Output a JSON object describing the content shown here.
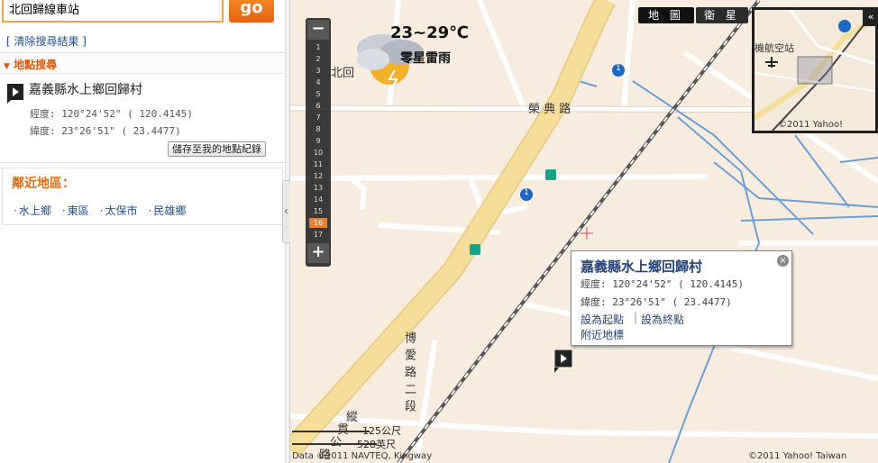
{
  "search": {
    "value": "北回歸線車站",
    "go_label": "go"
  },
  "sidebar": {
    "clear_results": "[ 清除搜尋結果 ]",
    "section_title": "地點搜尋",
    "result": {
      "title": "嘉義縣水上鄉回歸村",
      "longitude": "經度: 120°24'52\"  ( 120.4145)",
      "latitude": "緯度:  23°26'51\"  (  23.4477)",
      "save_label": "儲存至我的地點紀錄"
    },
    "nearby": {
      "title": "鄰近地區：",
      "items": [
        "水上鄉",
        "東區",
        "太保市",
        "民雄鄉"
      ]
    }
  },
  "map": {
    "zoom_levels": [
      "1",
      "2",
      "3",
      "4",
      "5",
      "6",
      "7",
      "8",
      "9",
      "10",
      "11",
      "12",
      "13",
      "14",
      "15",
      "16",
      "17"
    ],
    "active_zoom": "16",
    "weather": {
      "temp": "23~29℃",
      "desc": "零星雷雨"
    },
    "maptype": {
      "map_label": "地 圖",
      "satellite_label": "衛 星"
    },
    "minimap": {
      "label": "機航空站",
      "copyright": "©2011 Yahoo!",
      "toggle": "«"
    },
    "labels": {
      "rongdian_road": "榮 典 路",
      "beihui": "北回",
      "boai_road": "博愛路二段",
      "zong": "縱",
      "guan": "貫",
      "gong": "公",
      "lu": "路",
      "highway_shield": "1"
    },
    "popup": {
      "title": "嘉義縣水上鄉回歸村",
      "longitude": "經度: 120°24'52\"  ( 120.4145)",
      "latitude": "緯度:  23°26'51\"  (  23.4477)",
      "set_start": "設為起點",
      "set_end": "設為終點",
      "separator": "|",
      "nearby": "附近地標",
      "close": "×"
    },
    "scale": {
      "metric": "125公尺",
      "imperial": "528英尺"
    },
    "data_credit": "Data ©2011 NAVTEQ, Kingway",
    "copyright": "©2011 Yahoo! Taiwan"
  },
  "colors": {
    "accent_orange": "#e8731c",
    "link_blue": "#1f4f8f",
    "map_bg": "#f8ecdf",
    "highway_yellow": "#f5de9a",
    "water_blue": "#6aa0d6"
  }
}
